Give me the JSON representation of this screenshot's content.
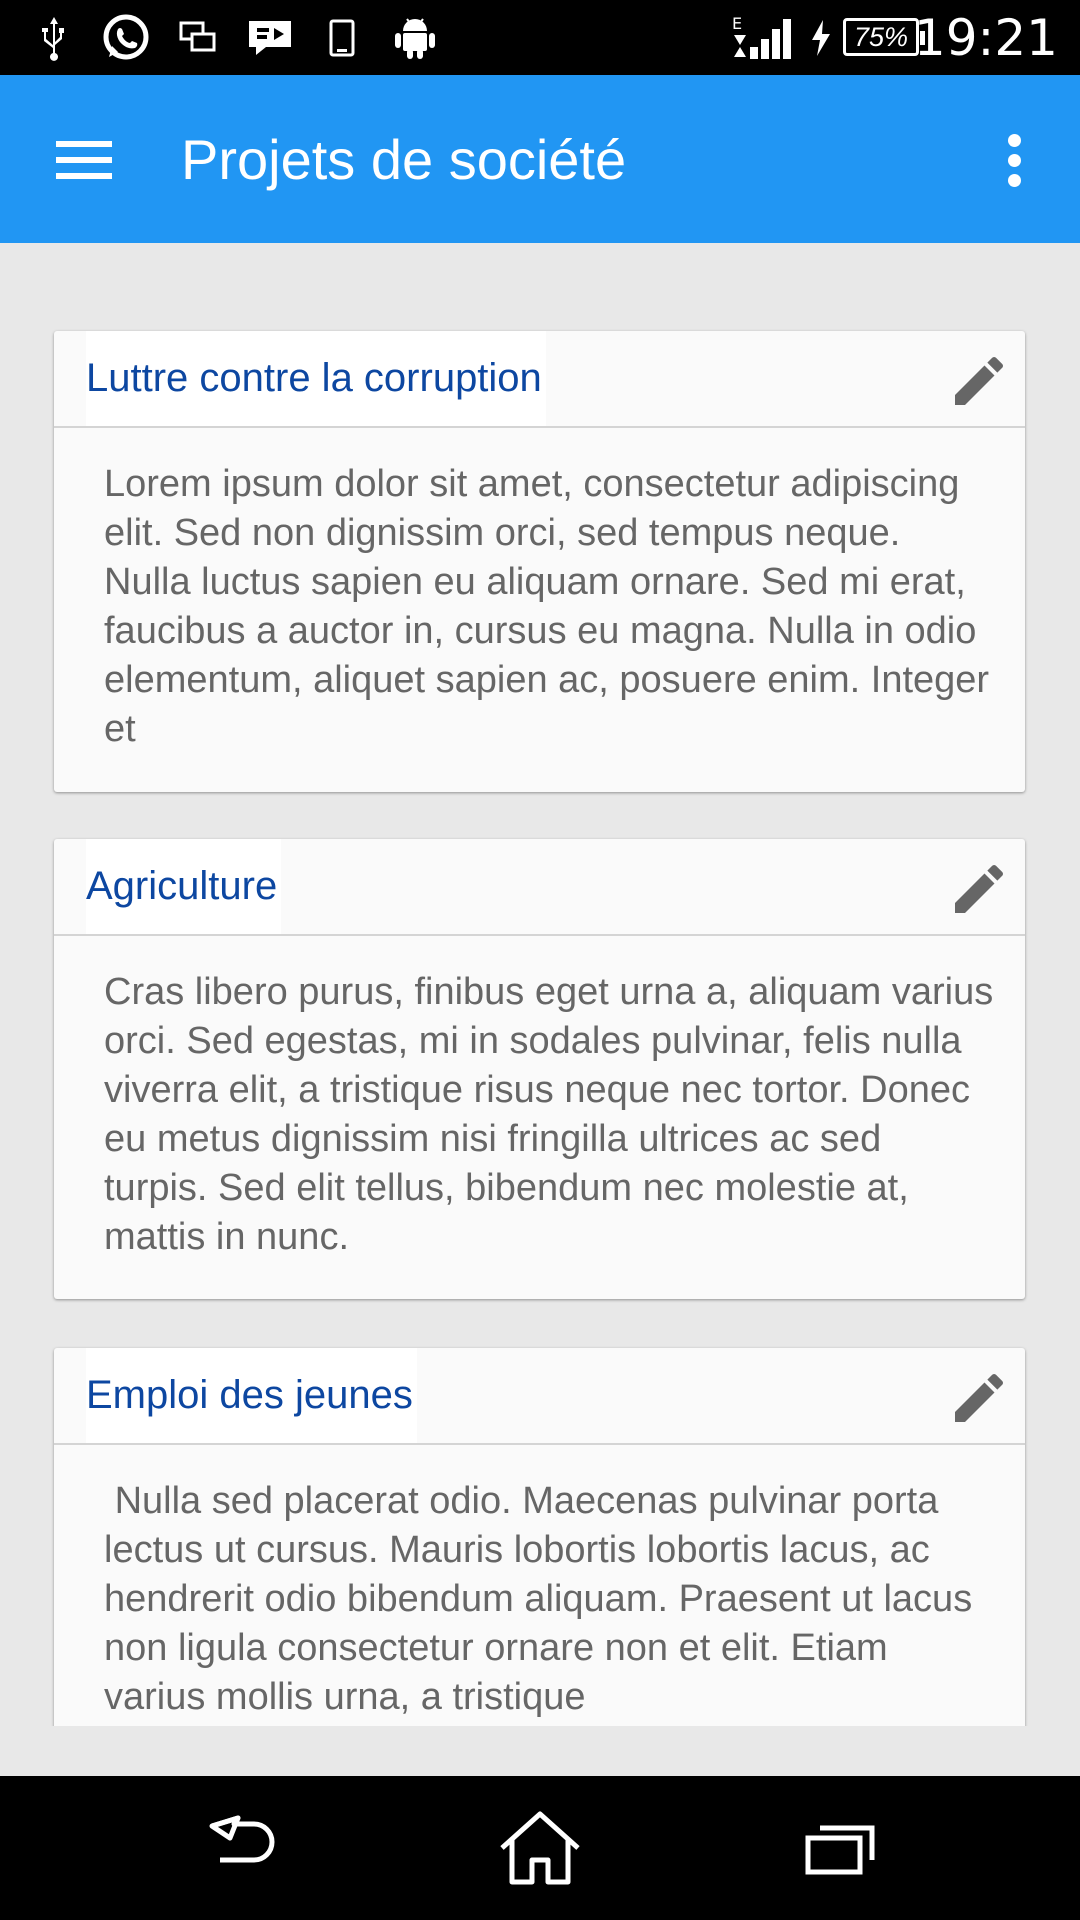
{
  "status_bar": {
    "left_icons": [
      "usb-icon",
      "whatsapp-icon",
      "screen-mirror-icon",
      "message-icon",
      "phone-icon",
      "android-icon"
    ],
    "network_label": "E",
    "battery": "75%",
    "time": "19:21"
  },
  "app_bar": {
    "title": "Projets de société",
    "menu_icon": "hamburger-menu-icon",
    "overflow_icon": "more-vert-icon"
  },
  "colors": {
    "app_bar": "#2196f3",
    "card_title": "#0d47a1",
    "body_text": "#666666",
    "background": "#e8e8e8"
  },
  "cards": [
    {
      "title": "Luttre contre la corruption",
      "body": "Lorem ipsum dolor sit amet, consectetur adipiscing elit. Sed non dignissim orci, sed tempus neque. Nulla luctus sapien eu aliquam ornare. Sed mi erat, faucibus a auctor in, cursus eu magna. Nulla in odio elementum, aliquet sapien ac, posuere enim. Integer et",
      "edit_icon": "pencil-icon"
    },
    {
      "title": "Agriculture",
      "body": "Cras libero purus, finibus eget urna a, aliquam varius orci. Sed egestas, mi in sodales pulvinar, felis nulla viverra elit, a tristique risus neque nec tortor. Donec eu metus dignissim nisi fringilla ultrices ac sed turpis. Sed elit tellus, bibendum nec molestie at, mattis in nunc.",
      "edit_icon": "pencil-icon"
    },
    {
      "title": "Emploi des jeunes",
      "body": " Nulla sed placerat odio. Maecenas pulvinar porta lectus ut cursus. Mauris lobortis lobortis lacus, ac hendrerit odio bibendum aliquam. Praesent ut lacus non ligula consectetur ornare non et elit. Etiam varius mollis urna, a tristique",
      "edit_icon": "pencil-icon"
    }
  ],
  "nav_bar": [
    "back-icon",
    "home-icon",
    "recent-apps-icon"
  ]
}
